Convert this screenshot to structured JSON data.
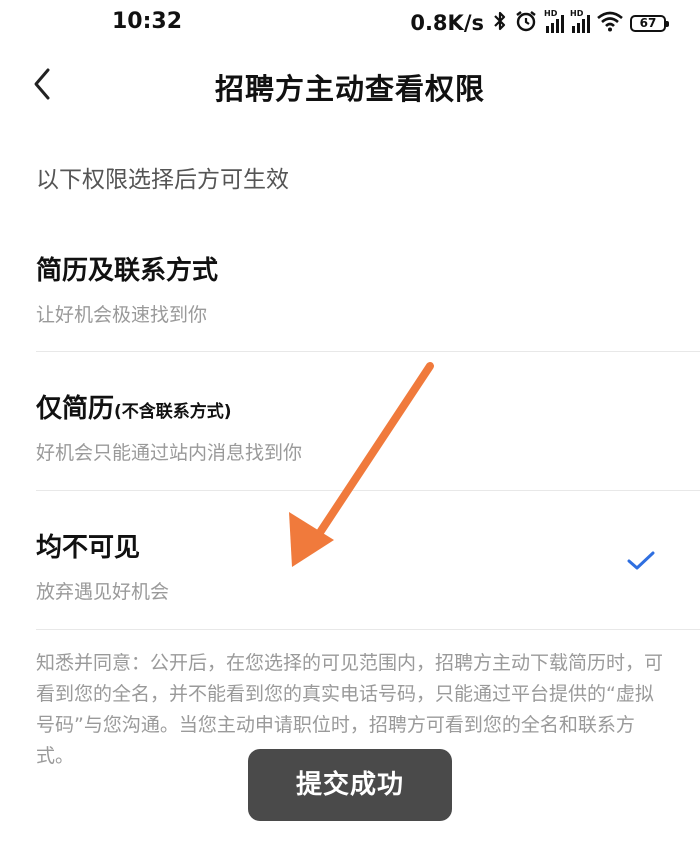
{
  "status_bar": {
    "time": "10:32",
    "net_speed": "0.8K/s",
    "battery": "67",
    "icons": [
      "bluetooth-icon",
      "alarm-icon",
      "signal-hd-icon",
      "signal-hd-icon",
      "wifi-icon",
      "battery-icon"
    ]
  },
  "nav": {
    "title": "招聘方主动查看权限",
    "back_icon": "chevron-left-icon"
  },
  "hint": "以下权限选择后方可生效",
  "options": [
    {
      "title": "简历及联系方式",
      "title_note": "",
      "subtitle": "让好机会极速找到你",
      "selected": false
    },
    {
      "title": "仅简历",
      "title_note": "(不含联系方式)",
      "subtitle": "好机会只能通过站内消息找到你",
      "selected": false
    },
    {
      "title": "均不可见",
      "title_note": "",
      "subtitle": "放弃遇见好机会",
      "selected": true
    }
  ],
  "notice": "知悉并同意：公开后，在您选择的可见范围内，招聘方主动下载简历时，可看到您的全名，并不能看到您的真实电话号码，只能通过平台提供的“虚拟号码”与您沟通。当您主动申请职位时，招聘方可看到您的全名和联系方式。",
  "toast": "提交成功",
  "colors": {
    "accent": "#2f6fe0",
    "arrow": "#f07a3c",
    "toast_bg": "#4a4a4a"
  }
}
